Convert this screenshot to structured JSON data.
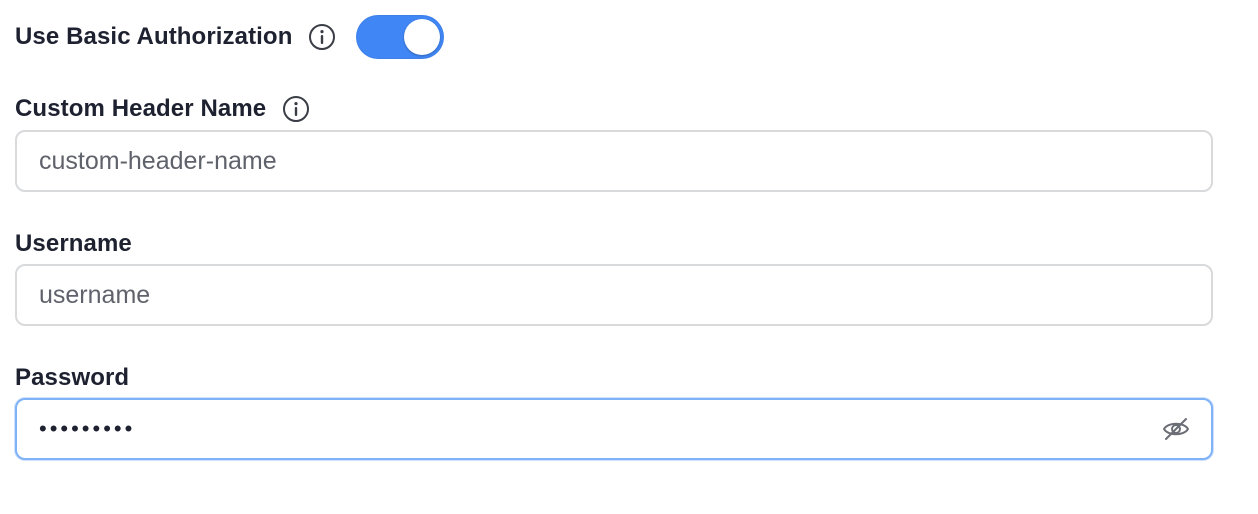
{
  "basic_auth": {
    "label": "Use Basic Authorization",
    "info_icon": "info-icon",
    "enabled": true,
    "toggle_color": "#4086f4"
  },
  "custom_header": {
    "label": "Custom Header Name",
    "info_icon": "info-icon",
    "placeholder": "custom-header-name",
    "value": ""
  },
  "username": {
    "label": "Username",
    "placeholder": "username",
    "value": ""
  },
  "password": {
    "label": "Password",
    "masked_value": "•••••••••",
    "visibility_icon": "eye-off-icon"
  }
}
